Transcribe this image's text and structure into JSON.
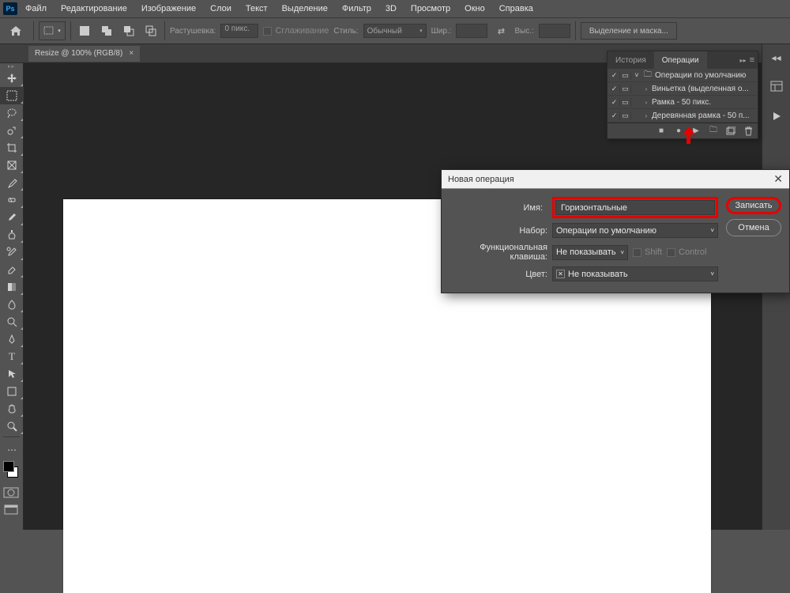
{
  "menu": [
    "Файл",
    "Редактирование",
    "Изображение",
    "Слои",
    "Текст",
    "Выделение",
    "Фильтр",
    "3D",
    "Просмотр",
    "Окно",
    "Справка"
  ],
  "options": {
    "feather_label": "Растушевка:",
    "feather_value": "0 пикс.",
    "antialias_label": "Сглаживание",
    "style_label": "Стиль:",
    "style_value": "Обычный",
    "width_label": "Шир.:",
    "height_label": "Выс.:",
    "select_mask": "Выделение и маска..."
  },
  "doc_tab": {
    "label": "Resize @ 100% (RGB/8)"
  },
  "panel": {
    "tab_history": "История",
    "tab_actions": "Операции",
    "rows": [
      {
        "label": "Операции по умолчанию",
        "folder": true
      },
      {
        "label": "Виньетка (выделенная о...",
        "folder": false
      },
      {
        "label": "Рамка - 50 пикс.",
        "folder": false
      },
      {
        "label": "Деревянная рамка - 50 п...",
        "folder": false
      }
    ]
  },
  "dialog": {
    "title": "Новая операция",
    "name_label": "Имя:",
    "name_value": "Горизонтальные",
    "set_label": "Набор:",
    "set_value": "Операции по умолчанию",
    "key_label": "Функциональная клавиша:",
    "key_value": "Не показывать",
    "shift": "Shift",
    "control": "Control",
    "color_label": "Цвет:",
    "color_value": "Не показывать",
    "record": "Записать",
    "cancel": "Отмена"
  }
}
